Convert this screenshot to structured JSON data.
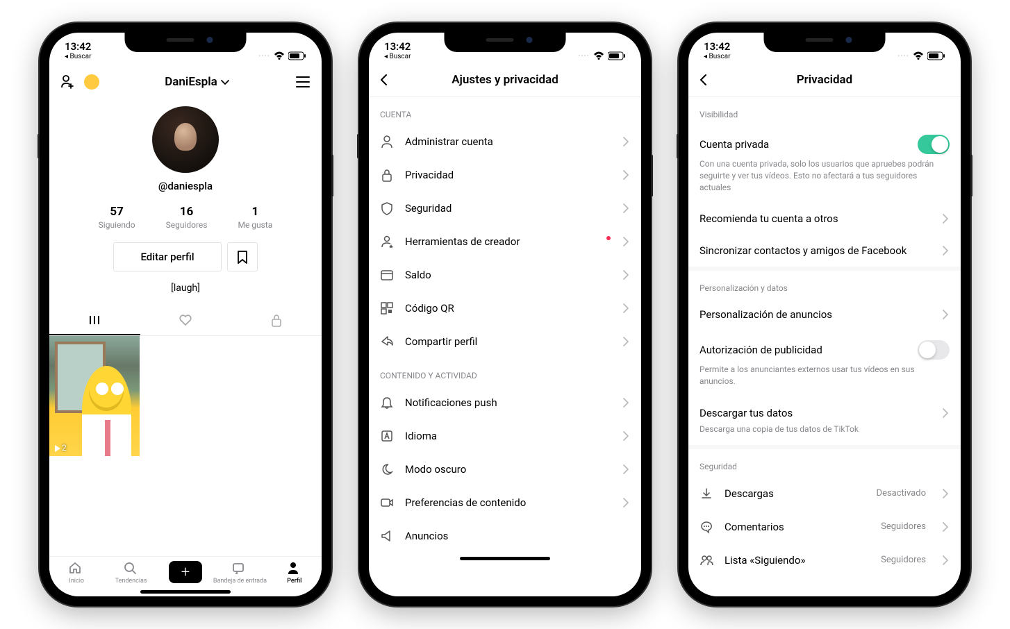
{
  "status": {
    "time": "13:42",
    "back": "◂ Buscar",
    "dots": "····"
  },
  "phone1": {
    "title": "DaniEspla",
    "username": "@daniespla",
    "stats": [
      {
        "num": "57",
        "label": "Siguiendo"
      },
      {
        "num": "16",
        "label": "Seguidores"
      },
      {
        "num": "1",
        "label": "Me gusta"
      }
    ],
    "edit": "Editar perfil",
    "bio": "[laugh]",
    "video_plays": "2",
    "nav": {
      "home": "Inicio",
      "trends": "Tendencias",
      "inbox": "Bandeja de entrada",
      "profile": "Perfil"
    }
  },
  "phone2": {
    "title": "Ajustes y privacidad",
    "sections": {
      "account_label": "CUENTA",
      "content_label": "CONTENIDO Y ACTIVIDAD"
    },
    "items": {
      "manage": "Administrar cuenta",
      "privacy": "Privacidad",
      "security": "Seguridad",
      "creator": "Herramientas de creador",
      "balance": "Saldo",
      "qr": "Código QR",
      "share": "Compartir perfil",
      "push": "Notificaciones push",
      "lang": "Idioma",
      "dark": "Modo oscuro",
      "contentpref": "Preferencias de contenido",
      "ads": "Anuncios"
    }
  },
  "phone3": {
    "title": "Privacidad",
    "sections": {
      "visibility": "Visibilidad",
      "personalization": "Personalización y datos",
      "security": "Seguridad"
    },
    "private_account": {
      "title": "Cuenta privada",
      "desc": "Con una cuenta privada, solo los usuarios que apruebes podrán seguirte y ver tus vídeos. Esto no afectará a tus seguidores actuales"
    },
    "recommend": "Recomienda tu cuenta a otros",
    "sync": "Sincronizar contactos y amigos de Facebook",
    "ads_personalization": "Personalización de anuncios",
    "ad_auth": {
      "title": "Autorización de publicidad",
      "desc": "Permite a los anunciantes externos usar tus vídeos en sus anuncios."
    },
    "download": {
      "title": "Descargar tus datos",
      "desc": "Descarga una copia de tus datos de TikTok"
    },
    "items": {
      "downloads": {
        "label": "Descargas",
        "value": "Desactivado"
      },
      "comments": {
        "label": "Comentarios",
        "value": "Seguidores"
      },
      "following": {
        "label": "Lista «Siguiendo»",
        "value": "Seguidores"
      }
    }
  }
}
